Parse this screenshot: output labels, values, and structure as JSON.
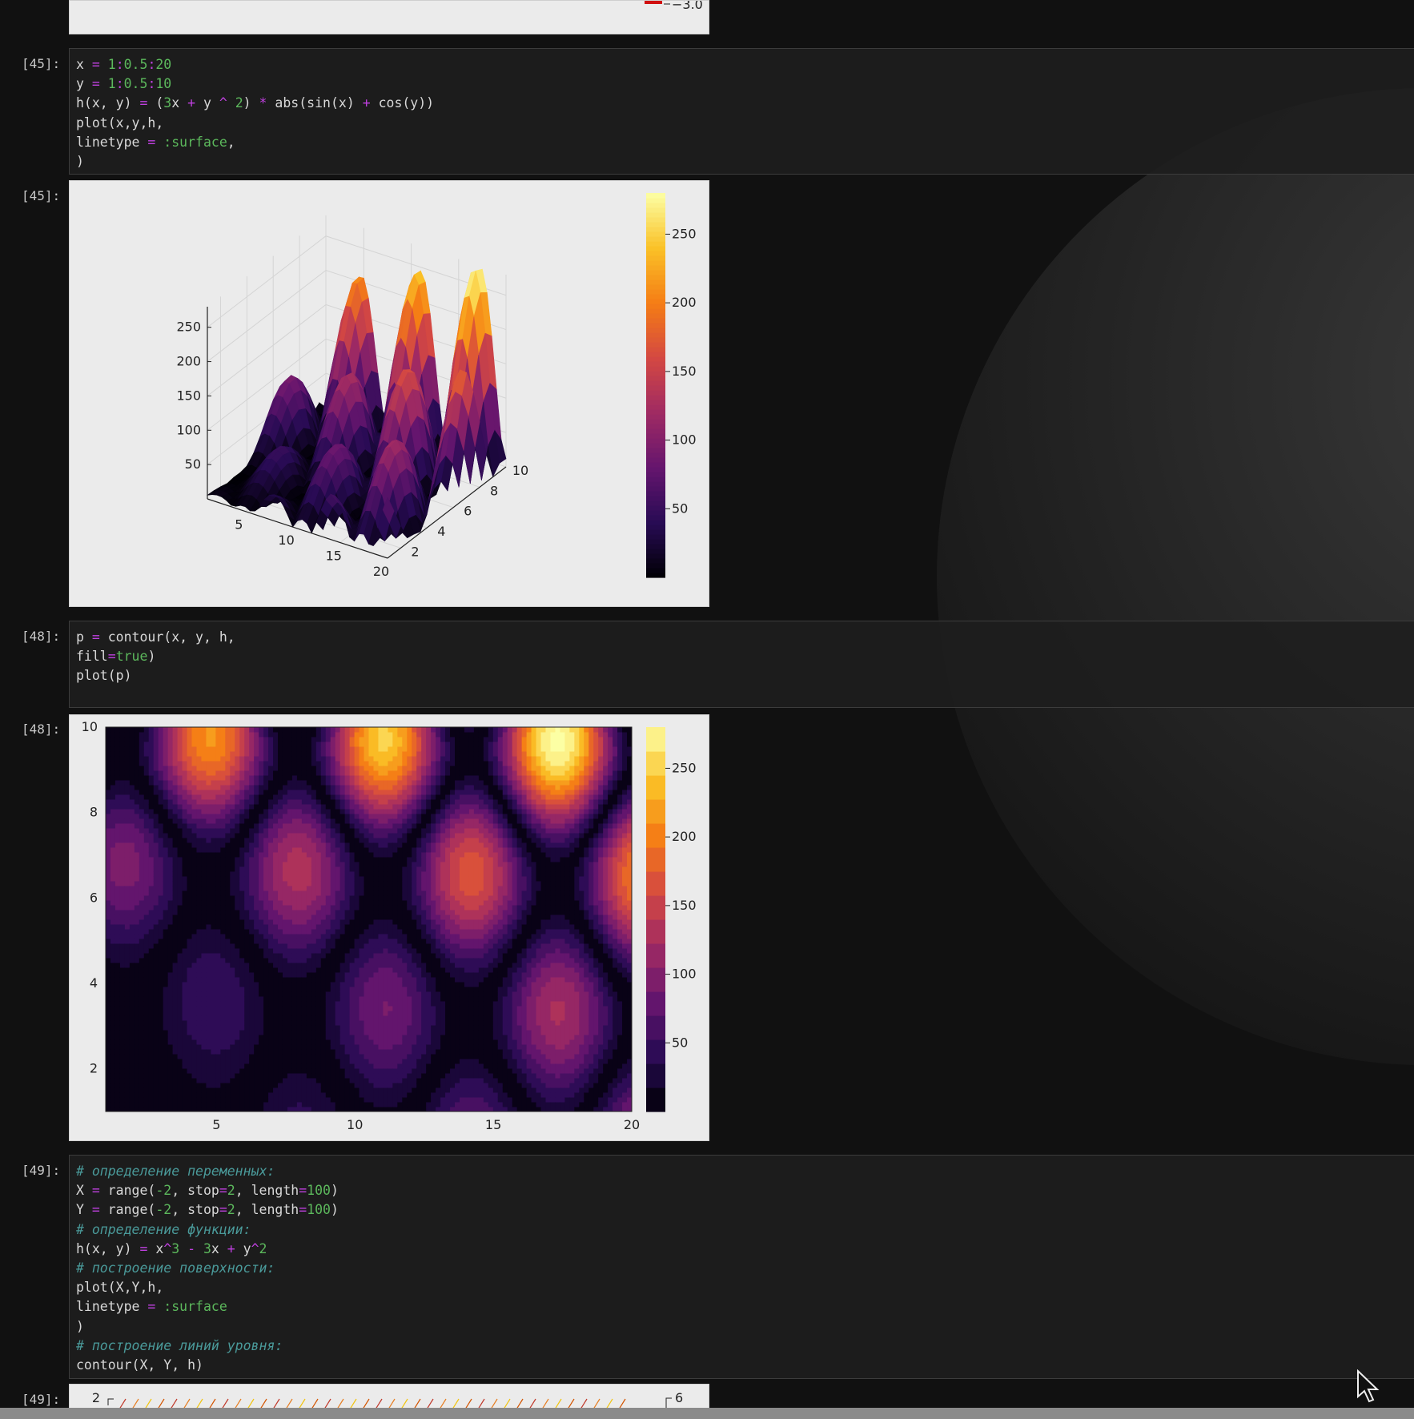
{
  "top_output": {
    "colorbar_tick": "−3.0"
  },
  "cells": [
    {
      "in_prompt": "[45]:",
      "code_lines": [
        [
          [
            "x ",
            ""
          ],
          [
            "=",
            "op"
          ],
          [
            " ",
            ""
          ],
          [
            "1",
            "num"
          ],
          [
            ":",
            "op"
          ],
          [
            "0.5",
            "num"
          ],
          [
            ":",
            "op"
          ],
          [
            "20",
            "num"
          ]
        ],
        [
          [
            "y ",
            ""
          ],
          [
            "=",
            "op"
          ],
          [
            " ",
            ""
          ],
          [
            "1",
            "num"
          ],
          [
            ":",
            "op"
          ],
          [
            "0.5",
            "num"
          ],
          [
            ":",
            "op"
          ],
          [
            "10",
            "num"
          ]
        ],
        [
          [
            "h(x, y) ",
            ""
          ],
          [
            "=",
            "op"
          ],
          [
            " (",
            ""
          ],
          [
            "3",
            "num"
          ],
          [
            "x ",
            ""
          ],
          [
            "+",
            "op"
          ],
          [
            " y ",
            ""
          ],
          [
            "^",
            "op"
          ],
          [
            " ",
            ""
          ],
          [
            "2",
            "num"
          ],
          [
            ") ",
            ""
          ],
          [
            "*",
            "op"
          ],
          [
            " abs(sin(x) ",
            ""
          ],
          [
            "+",
            "op"
          ],
          [
            " cos(y))",
            ""
          ]
        ],
        [
          [
            "plot(x,y,h,",
            ""
          ]
        ],
        [
          [
            "linetype ",
            ""
          ],
          [
            "=",
            "op"
          ],
          [
            " ",
            ""
          ],
          [
            ":surface",
            "sym"
          ],
          [
            ",",
            ""
          ]
        ],
        [
          [
            ")",
            ""
          ]
        ]
      ],
      "out_prompt": "[45]:"
    },
    {
      "in_prompt": "[48]:",
      "code_lines": [
        [
          [
            "p ",
            ""
          ],
          [
            "=",
            "op"
          ],
          [
            " contour(x, y, h,",
            ""
          ]
        ],
        [
          [
            "fill",
            ""
          ],
          [
            "=",
            "op"
          ],
          [
            "true",
            "kw"
          ],
          [
            ")",
            ""
          ]
        ],
        [
          [
            "plot(p)",
            ""
          ]
        ]
      ],
      "out_prompt": "[48]:"
    },
    {
      "in_prompt": "[49]:",
      "code_lines": [
        [
          [
            "# определение переменных:",
            "cm"
          ]
        ],
        [
          [
            "X ",
            ""
          ],
          [
            "=",
            "op"
          ],
          [
            " range(",
            ""
          ],
          [
            "-2",
            "num"
          ],
          [
            ", stop",
            ""
          ],
          [
            "=",
            "op"
          ],
          [
            "2",
            "num"
          ],
          [
            ", length",
            ""
          ],
          [
            "=",
            "op"
          ],
          [
            "100",
            "num"
          ],
          [
            ")",
            ""
          ]
        ],
        [
          [
            "Y ",
            ""
          ],
          [
            "=",
            "op"
          ],
          [
            " range(",
            ""
          ],
          [
            "-2",
            "num"
          ],
          [
            ", stop",
            ""
          ],
          [
            "=",
            "op"
          ],
          [
            "2",
            "num"
          ],
          [
            ", length",
            ""
          ],
          [
            "=",
            "op"
          ],
          [
            "100",
            "num"
          ],
          [
            ")",
            ""
          ]
        ],
        [
          [
            "# определение функции:",
            "cm"
          ]
        ],
        [
          [
            "h(x, y) ",
            ""
          ],
          [
            "=",
            "op"
          ],
          [
            " x",
            ""
          ],
          [
            "^",
            "op"
          ],
          [
            "3",
            "num"
          ],
          [
            " ",
            ""
          ],
          [
            "-",
            "op"
          ],
          [
            " ",
            ""
          ],
          [
            "3",
            "num"
          ],
          [
            "x ",
            ""
          ],
          [
            "+",
            "op"
          ],
          [
            " y",
            ""
          ],
          [
            "^",
            "op"
          ],
          [
            "2",
            "num"
          ]
        ],
        [
          [
            "# построение поверхности:",
            "cm"
          ]
        ],
        [
          [
            "plot(X,Y,h,",
            ""
          ]
        ],
        [
          [
            "linetype ",
            ""
          ],
          [
            "=",
            "op"
          ],
          [
            " ",
            ""
          ],
          [
            ":surface",
            "sym"
          ]
        ],
        [
          [
            ")",
            ""
          ]
        ],
        [
          [
            "# построение линий уровня:",
            "cm"
          ]
        ],
        [
          [
            "contour(X, Y, h)",
            ""
          ]
        ]
      ],
      "out_prompt": "[49]:"
    }
  ],
  "chart_data": [
    {
      "type": "surface",
      "function": "h(x, y) = (3x + y ^ 2) * abs(sin(x) + cos(y))",
      "x_ticks": [
        5,
        10,
        15,
        20
      ],
      "y_ticks": [
        2,
        4,
        6,
        8,
        10
      ],
      "z_ticks": [
        50,
        100,
        150,
        200,
        250
      ],
      "xlim": [
        1,
        20
      ],
      "ylim": [
        1,
        10
      ],
      "zlim": [
        0,
        280
      ],
      "colorbar_ticks": [
        50,
        100,
        150,
        200,
        250
      ],
      "colormap": "inferno"
    },
    {
      "type": "contour",
      "function": "h(x, y) = (3x + y ^ 2) * abs(sin(x) + cos(y))",
      "x_ticks": [
        5,
        10,
        15,
        20
      ],
      "y_ticks": [
        2,
        4,
        6,
        8,
        10
      ],
      "xlim": [
        1,
        20
      ],
      "ylim": [
        1,
        10
      ],
      "colorbar_ticks": [
        50,
        100,
        150,
        200,
        250
      ],
      "colormap": "inferno",
      "fill": true
    },
    {
      "type": "contour",
      "partial": true,
      "visible_y_tick": "2",
      "visible_colorbar_tick": "6"
    }
  ]
}
